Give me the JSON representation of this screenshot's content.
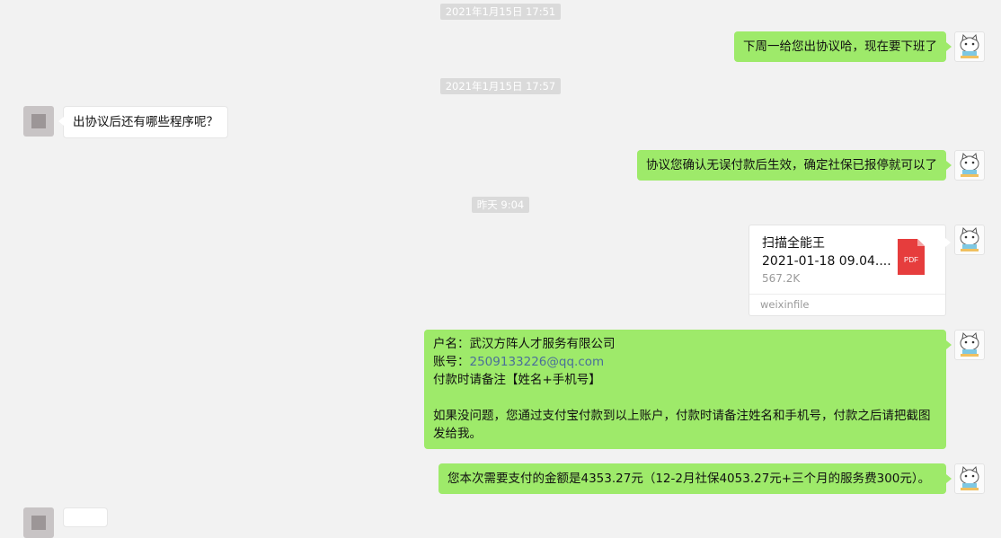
{
  "timestamps": {
    "t1": "2021年1月15日 17:51",
    "t2": "2021年1月15日 17:57",
    "t3": "昨天 9:04"
  },
  "messages": {
    "m1": "下周一给您出协议哈，现在要下班了",
    "m2": "出协议后还有哪些程序呢？",
    "m3": "协议您确认无误付款后生效，确定社保已报停就可以了",
    "m5_line1": "户名：武汉方阵人才服务有限公司",
    "m5_line2_prefix": "账号：",
    "m5_line2_link": "2509133226@qq.com",
    "m5_line3": "付款时请备注【姓名+手机号】",
    "m5_line5": "如果没问题，您通过支付宝付款到以上账户，付款时请备注姓名和手机号，付款之后请把截图发给我。",
    "m6": "您本次需要支付的金额是4353.27元（12-2月社保4053.27元+三个月的服务费300元）。"
  },
  "file": {
    "name": "扫描全能王",
    "subtitle": "2021-01-18 09.04....",
    "size": "567.2K",
    "source": "weixinfile",
    "type_label": "PDF",
    "icon": "pdf-file-icon",
    "icon_color": "#e63d3d"
  },
  "colors": {
    "background": "#f2f2f2",
    "sent_bubble": "#9eea6a",
    "received_bubble": "#ffffff",
    "timestamp_bg": "#dadada"
  }
}
